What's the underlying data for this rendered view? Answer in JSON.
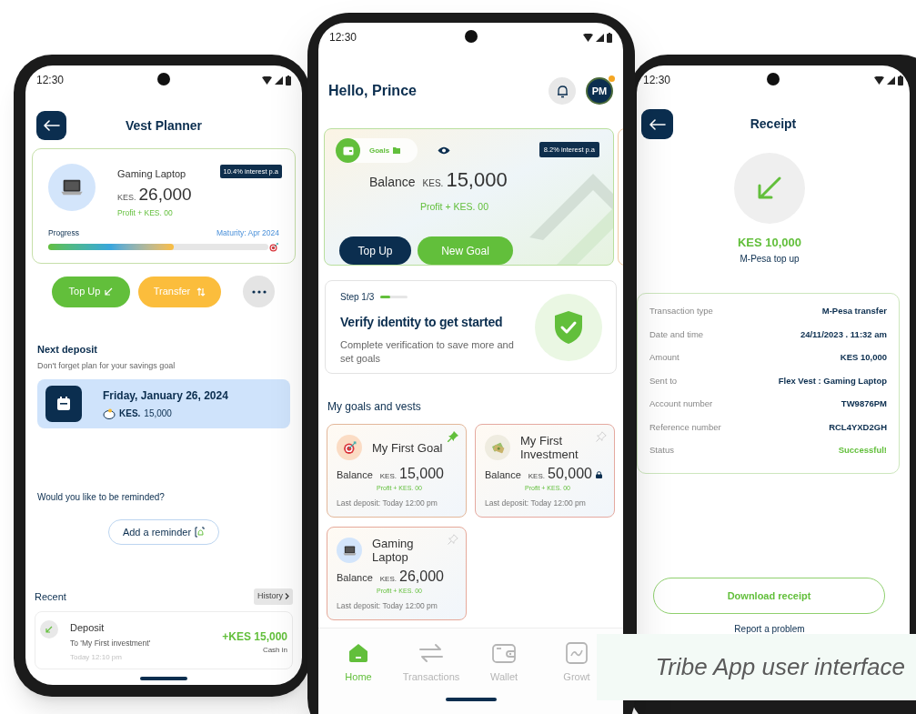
{
  "vest_planner": {
    "status_time": "12:30",
    "title": "Vest Planner",
    "goal": {
      "name": "Gaming Laptop",
      "currency": "KES.",
      "amount": "26,000",
      "profit": "Profit + KES. 00",
      "interest": "10.4% interest p.a",
      "progress_label": "Progress",
      "maturity": "Maturity: Apr 2024",
      "level": 0.57
    },
    "actions": [
      {
        "kind": "top_up",
        "label": "Top Up"
      },
      {
        "kind": "transfer",
        "label": "Transfer"
      },
      {
        "kind": "more"
      }
    ],
    "next_deposit": {
      "title": "Next deposit",
      "subtitle": "Don't forget plan for your savings goal",
      "date": "Friday, January 26, 2024",
      "currency": "KES.",
      "amount": "15,000"
    },
    "reminder": {
      "question": "Would you like to be reminded?",
      "button": "Add a reminder"
    },
    "recent": {
      "title": "Recent",
      "history_button": "History",
      "items": [
        {
          "title": "Deposit",
          "subtitle": "To 'My First investment'",
          "time": "Today 12:10 pm",
          "amount": "+KES 15,000",
          "type": "Cash in"
        }
      ]
    }
  },
  "home": {
    "status_time": "12:30",
    "greeting": "Hello, Prince",
    "avatar_initials": "PM",
    "balance_card": {
      "chip_label": "Goals",
      "interest": "8.2% interest p.a",
      "balance_label": "Balance",
      "currency": "KES.",
      "amount": "15,000",
      "profit": "Profit + KES. 00",
      "buttons": [
        {
          "kind": "primary",
          "label": "Top Up"
        },
        {
          "kind": "accent",
          "label": "New Goal"
        }
      ]
    },
    "verify": {
      "step": "Step 1/3",
      "level": 0.35,
      "title": "Verify identity to get started",
      "description": "Complete verification to save more and set goals"
    },
    "goals_title": "My goals and vests",
    "goals": [
      {
        "kind": "target",
        "name": "My First Goal",
        "balance_label": "Balance",
        "currency": "KES.",
        "amount": "15,000",
        "profit": "Profit + KES. 00",
        "last_deposit": "Last deposit: Today 12:00 pm",
        "pinned": true,
        "locked": false
      },
      {
        "kind": "money",
        "name": "My First Investment",
        "balance_label": "Balance",
        "currency": "KES.",
        "amount": "50,000",
        "profit": "Profit + KES. 00",
        "last_deposit": "Last deposit: Today 12:00 pm",
        "pinned": false,
        "locked": true
      },
      {
        "kind": "laptop",
        "name": "Gaming Laptop",
        "balance_label": "Balance",
        "currency": "KES.",
        "amount": "26,000",
        "profit": "Profit + KES. 00",
        "last_deposit": "Last deposit: Today 12:00 pm",
        "pinned": false,
        "locked": false
      }
    ],
    "nav": [
      {
        "kind": "home",
        "label": "Home",
        "selected": true
      },
      {
        "kind": "transactions",
        "label": "Transactions",
        "selected": false
      },
      {
        "kind": "wallet",
        "label": "Wallet",
        "selected": false
      },
      {
        "kind": "growth",
        "label": "Growt",
        "selected": false
      }
    ]
  },
  "receipt": {
    "status_time": "12:30",
    "title": "Receipt",
    "amount": "KES 10,000",
    "subtitle": "M-Pesa top up",
    "details": [
      {
        "label": "Transaction type",
        "value": "M-Pesa transfer",
        "kind": "plain"
      },
      {
        "label": "Date and time",
        "value": "24/11/2023 . 11:32 am",
        "kind": "plain"
      },
      {
        "label": "Amount",
        "value": "KES 10,000",
        "kind": "plain"
      },
      {
        "label": "Sent to",
        "value": "Flex Vest : Gaming Laptop",
        "kind": "plain"
      },
      {
        "label": "Account number",
        "value": "TW9876PM",
        "kind": "plain"
      },
      {
        "label": "Reference number",
        "value": "RCL4YXD2GH",
        "kind": "plain"
      },
      {
        "label": "Status",
        "value": "Successful!",
        "kind": "success"
      }
    ],
    "download_button": "Download receipt",
    "report_link": "Report a problem"
  },
  "caption": "Tribe App user interface"
}
